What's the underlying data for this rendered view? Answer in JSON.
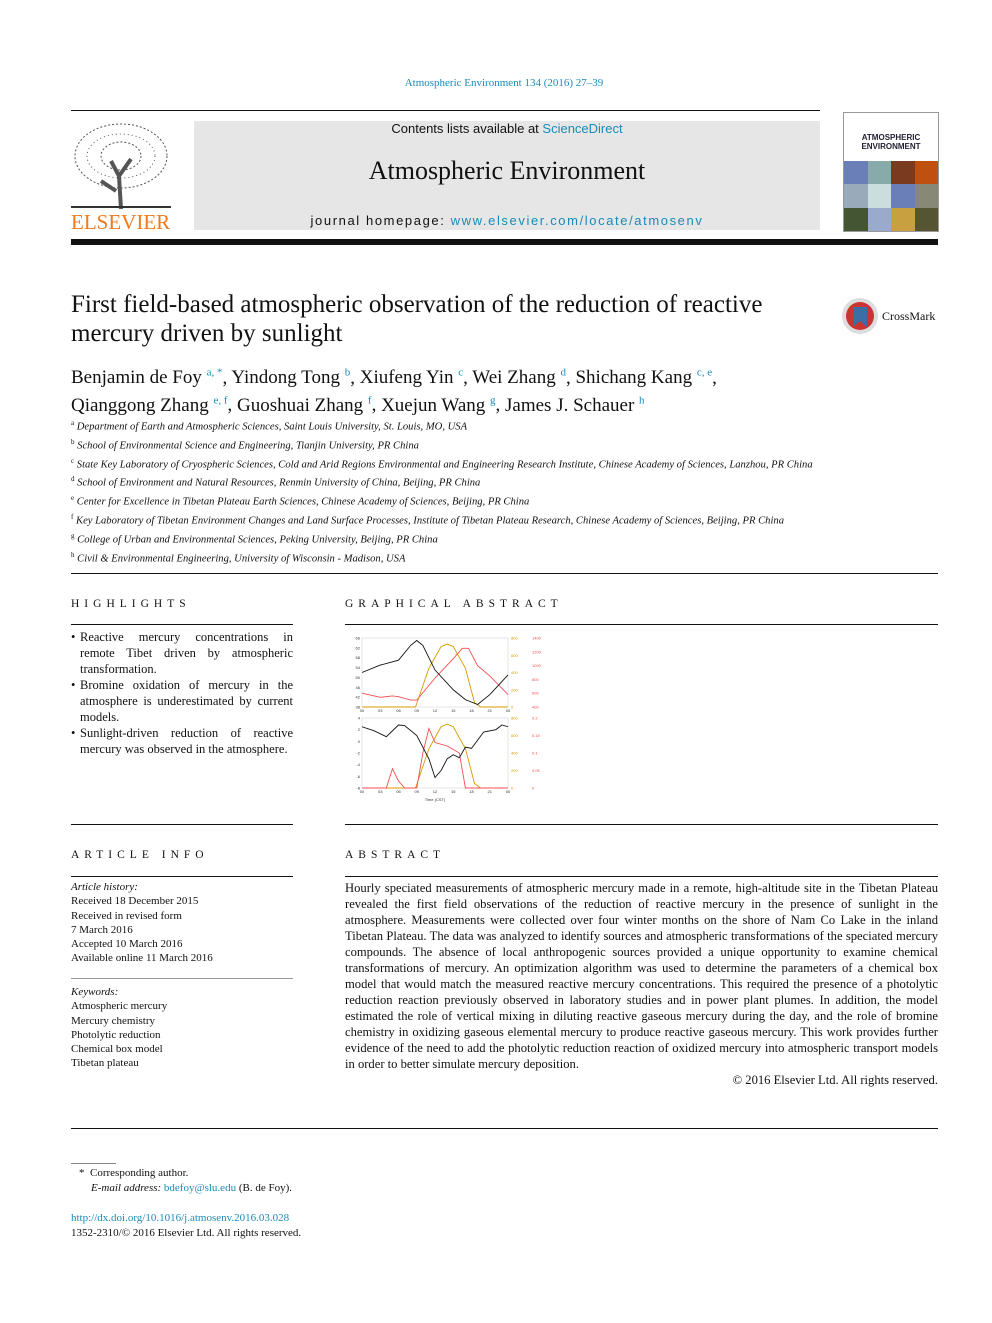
{
  "header": {
    "journal_ref": "Atmospheric Environment 134 (2016) 27–39",
    "contents_prefix": "Contents lists available at ",
    "contents_link": "ScienceDirect",
    "journal_title": "Atmospheric Environment",
    "homepage_prefix": "journal homepage: ",
    "homepage_link": "www.elsevier.com/locate/atmosenv",
    "publisher_logo": "ELSEVIER",
    "cover_title": "ATMOSPHERIC ENVIRONMENT",
    "crossmark": "CrossMark"
  },
  "article": {
    "title": "First field-based atmospheric observation of the reduction of reactive mercury driven by sunlight",
    "authors": [
      {
        "name": "Benjamin de Foy",
        "sup": "a, *"
      },
      {
        "name": "Yindong Tong",
        "sup": "b"
      },
      {
        "name": "Xiufeng Yin",
        "sup": "c"
      },
      {
        "name": "Wei Zhang",
        "sup": "d"
      },
      {
        "name": "Shichang Kang",
        "sup": "c, e"
      },
      {
        "name": "Qianggong Zhang",
        "sup": "e, f"
      },
      {
        "name": "Guoshuai Zhang",
        "sup": "f"
      },
      {
        "name": "Xuejun Wang",
        "sup": "g"
      },
      {
        "name": "James J. Schauer",
        "sup": "h"
      }
    ],
    "affiliations": [
      {
        "key": "a",
        "text": "Department of Earth and Atmospheric Sciences, Saint Louis University, St. Louis, MO, USA"
      },
      {
        "key": "b",
        "text": "School of Environmental Science and Engineering, Tianjin University, PR China"
      },
      {
        "key": "c",
        "text": "State Key Laboratory of Cryospheric Sciences, Cold and Arid Regions Environmental and Engineering Research Institute, Chinese Academy of Sciences, Lanzhou, PR China"
      },
      {
        "key": "d",
        "text": "School of Environment and Natural Resources, Renmin University of China, Beijing, PR China"
      },
      {
        "key": "e",
        "text": "Center for Excellence in Tibetan Plateau Earth Sciences, Chinese Academy of Sciences, Beijing, PR China"
      },
      {
        "key": "f",
        "text": "Key Laboratory of Tibetan Environment Changes and Land Surface Processes, Institute of Tibetan Plateau Research, Chinese Academy of Sciences, Beijing, PR China"
      },
      {
        "key": "g",
        "text": "College of Urban and Environmental Sciences, Peking University, Beijing, PR China"
      },
      {
        "key": "h",
        "text": "Civil & Environmental Engineering, University of Wisconsin - Madison, USA"
      }
    ]
  },
  "highlights": {
    "heading": "HIGHLIGHTS",
    "items": [
      "Reactive mercury concentrations in remote Tibet driven by atmospheric transformation.",
      "Bromine oxidation of mercury in the atmosphere is underestimated by current models.",
      "Sunlight-driven reduction of reactive mercury was observed in the atmosphere."
    ]
  },
  "graphical_abstract": {
    "heading": "GRAPHICAL ABSTRACT",
    "xlabel": "Time (CST)",
    "xticks": [
      "00",
      "03",
      "06",
      "09",
      "12",
      "15",
      "18",
      "21",
      "00"
    ],
    "top": {
      "yticks_left": [
        38,
        42,
        46,
        50,
        54,
        58,
        62,
        66
      ],
      "yticks_solar": [
        0,
        200,
        400,
        600,
        800
      ],
      "yticks_pblh": [
        400,
        600,
        800,
        1000,
        1200,
        1400
      ],
      "black": [
        [
          0,
          52
        ],
        [
          3,
          55
        ],
        [
          6,
          57
        ],
        [
          8,
          63
        ],
        [
          9,
          65
        ],
        [
          10,
          63
        ],
        [
          12,
          53
        ],
        [
          15,
          45
        ],
        [
          17,
          41
        ],
        [
          19,
          39
        ],
        [
          21,
          43
        ],
        [
          24,
          51
        ]
      ],
      "solar": [
        [
          0,
          0
        ],
        [
          8.8,
          0
        ],
        [
          11,
          450
        ],
        [
          13,
          700
        ],
        [
          14,
          730
        ],
        [
          15,
          700
        ],
        [
          17,
          450
        ],
        [
          18.5,
          50
        ],
        [
          19.5,
          0
        ],
        [
          24,
          0
        ]
      ],
      "pblh": [
        [
          0,
          600
        ],
        [
          3,
          540
        ],
        [
          5,
          560
        ],
        [
          6,
          550
        ],
        [
          8,
          500
        ],
        [
          9,
          500
        ],
        [
          12,
          820
        ],
        [
          15,
          1100
        ],
        [
          16.5,
          1250
        ],
        [
          17.5,
          1250
        ],
        [
          19,
          1000
        ],
        [
          21,
          850
        ],
        [
          24,
          580
        ]
      ]
    },
    "bottom": {
      "yticks_left": [
        -8,
        -6,
        -4,
        -2,
        0,
        2,
        4
      ],
      "yticks_solar": [
        0,
        200,
        400,
        600,
        800
      ],
      "yticks_right": [
        0,
        0.05,
        0.1,
        0.15,
        0.2
      ],
      "black": [
        [
          0,
          2.5
        ],
        [
          2,
          1.8
        ],
        [
          4,
          0.8
        ],
        [
          6,
          2.8
        ],
        [
          7,
          2.7
        ],
        [
          9,
          1
        ],
        [
          11,
          -3
        ],
        [
          12,
          -6.2
        ],
        [
          13,
          -5
        ],
        [
          14,
          -3
        ],
        [
          15,
          -2.3
        ],
        [
          16,
          -2.8
        ],
        [
          17,
          -1
        ],
        [
          18,
          -1.2
        ],
        [
          20,
          1.6
        ],
        [
          22,
          2
        ],
        [
          23,
          2.8
        ],
        [
          24,
          2.5
        ]
      ],
      "solar": [
        [
          0,
          0
        ],
        [
          8.8,
          0
        ],
        [
          11,
          450
        ],
        [
          13,
          700
        ],
        [
          14,
          730
        ],
        [
          15,
          700
        ],
        [
          17,
          450
        ],
        [
          18.5,
          50
        ],
        [
          19.5,
          0
        ],
        [
          24,
          0
        ]
      ],
      "red": [
        [
          0,
          0
        ],
        [
          4,
          0
        ],
        [
          5,
          0.055
        ],
        [
          6,
          0.02
        ],
        [
          7,
          0
        ],
        [
          9,
          0
        ],
        [
          10,
          0.1
        ],
        [
          11,
          0.17
        ],
        [
          12,
          0.13
        ],
        [
          14,
          0.12
        ],
        [
          15,
          0.11
        ],
        [
          16,
          0.1
        ],
        [
          17,
          0
        ],
        [
          24,
          0
        ]
      ]
    },
    "colors": {
      "black": "#111111",
      "solar": "#d99a00",
      "red": "#f05050"
    }
  },
  "article_info": {
    "heading": "ARTICLE INFO",
    "history_label": "Article history:",
    "history": [
      "Received 18 December 2015",
      "Received in revised form",
      "7 March 2016",
      "Accepted 10 March 2016",
      "Available online 11 March 2016"
    ],
    "keywords_label": "Keywords:",
    "keywords": [
      "Atmospheric mercury",
      "Mercury chemistry",
      "Photolytic reduction",
      "Chemical box model",
      "Tibetan plateau"
    ]
  },
  "abstract": {
    "heading": "ABSTRACT",
    "text": "Hourly speciated measurements of atmospheric mercury made in a remote, high-altitude site in the Tibetan Plateau revealed the first field observations of the reduction of reactive mercury in the presence of sunlight in the atmosphere. Measurements were collected over four winter months on the shore of Nam Co Lake in the inland Tibetan Plateau. The data was analyzed to identify sources and atmospheric transformations of the speciated mercury compounds. The absence of local anthropogenic sources provided a unique opportunity to examine chemical transformations of mercury. An optimization algorithm was used to determine the parameters of a chemical box model that would match the measured reactive mercury concentrations. This required the presence of a photolytic reduction reaction previously observed in laboratory studies and in power plant plumes. In addition, the model estimated the role of vertical mixing in diluting reactive gaseous mercury during the day, and the role of bromine chemistry in oxidizing gaseous elemental mercury to produce reactive gaseous mercury. This work provides further evidence of the need to add the photolytic reduction reaction of oxidized mercury into atmospheric transport models in order to better simulate mercury deposition.",
    "copyright": "© 2016 Elsevier Ltd. All rights reserved."
  },
  "footer": {
    "corr_mark": "*",
    "corr": "Corresponding author.",
    "email_label": "E-mail address: ",
    "email": "bdefoy@slu.edu",
    "email_suffix": " (B. de Foy).",
    "doi": "http://dx.doi.org/10.1016/j.atmosenv.2016.03.028",
    "issn": "1352-2310/© 2016 Elsevier Ltd. All rights reserved."
  }
}
